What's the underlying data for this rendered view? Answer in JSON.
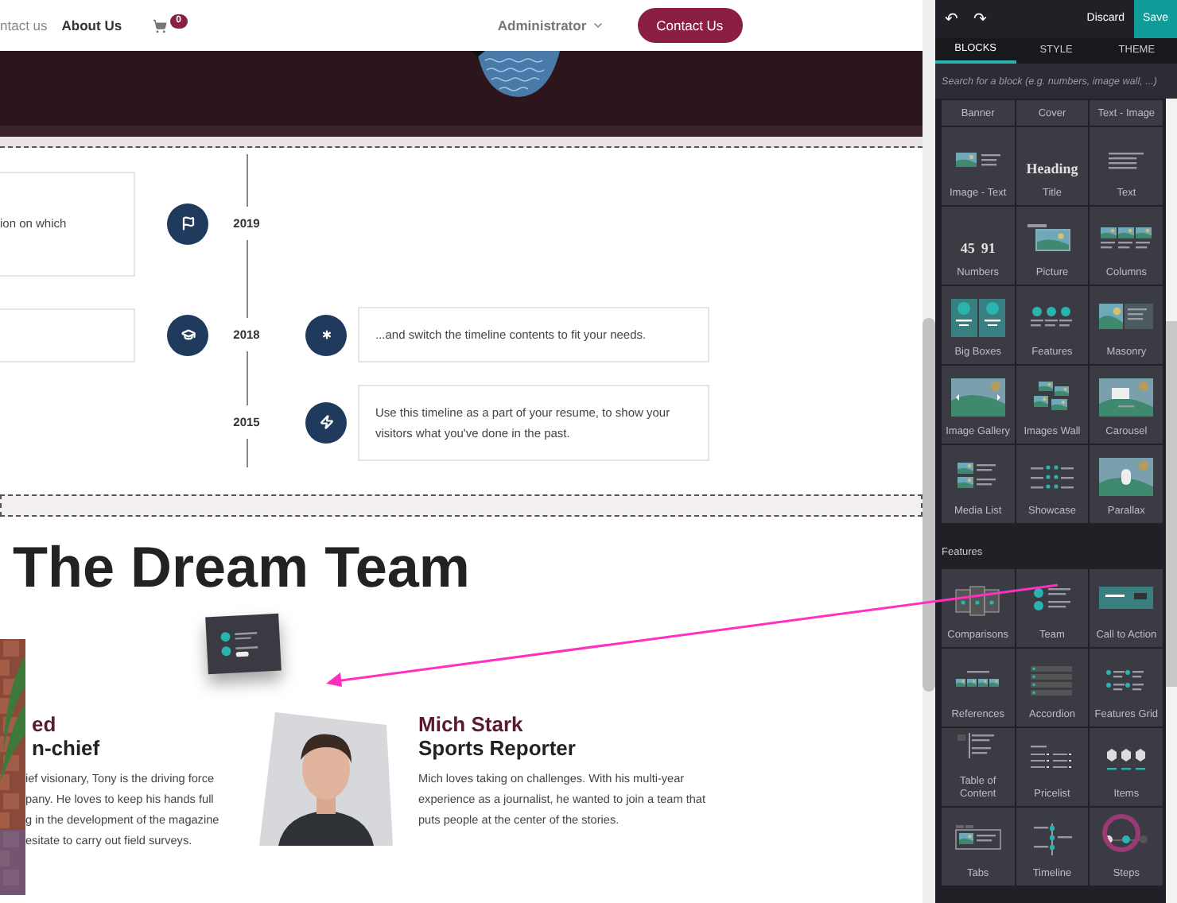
{
  "navbar": {
    "links": [
      {
        "label": "ntact us",
        "selected": false
      },
      {
        "label": "About Us",
        "selected": true
      }
    ],
    "cart_count": "0",
    "user": "Administrator",
    "cta": "Contact Us"
  },
  "timeline": {
    "rows": [
      {
        "year": "2019",
        "left_card": true,
        "left_text": "ion on which",
        "right_card": false
      },
      {
        "year": "2018",
        "left_card": true,
        "right_card": true,
        "right_text": "...and switch the timeline contents to fit your needs."
      },
      {
        "year": "2015",
        "left_card": false,
        "right_card": true,
        "right_text": "Use this timeline as a part of your resume, to show your visitors what you've done in the past."
      }
    ]
  },
  "team": {
    "heading": "The Dream Team",
    "members": [
      {
        "name": "ed",
        "role": "n-chief",
        "bio_lines": [
          "ief visionary, Tony is the driving force",
          "pany. He loves to keep his hands full",
          "g in the development of the magazine",
          "esitate to carry out field surveys."
        ]
      },
      {
        "name": "Mich Stark",
        "role": "Sports Reporter",
        "bio": "Mich loves taking on challenges. With his multi-year experience as a journalist, he wanted to join a team that puts people at the center of the stories."
      }
    ]
  },
  "panel": {
    "undo": "↶",
    "redo": "↷",
    "discard": "Discard",
    "save": "Save",
    "tabs": [
      {
        "label": "BLOCKS",
        "selected": true
      },
      {
        "label": "STYLE",
        "selected": false
      },
      {
        "label": "THEME",
        "selected": false
      }
    ],
    "search": {
      "placeholder": "Search for a block (e.g. numbers, image wall, ...)"
    },
    "sections": [
      {
        "blocks": [
          {
            "label": "Banner"
          },
          {
            "label": "Cover"
          },
          {
            "label": "Text - Image"
          },
          {
            "label": "Image - Text",
            "kind": "image-text"
          },
          {
            "label": "Title",
            "kind": "heading",
            "previews": [
              "Heading"
            ]
          },
          {
            "label": "Text",
            "kind": "text"
          },
          {
            "label": "Numbers",
            "kind": "numbers",
            "previews": [
              "45",
              "91"
            ]
          },
          {
            "label": "Picture",
            "kind": "picture"
          },
          {
            "label": "Columns",
            "kind": "columns"
          },
          {
            "label": "Big Boxes",
            "kind": "big-boxes"
          },
          {
            "label": "Features",
            "kind": "features"
          },
          {
            "label": "Masonry",
            "kind": "masonry"
          },
          {
            "label": "Image Gallery",
            "kind": "gallery"
          },
          {
            "label": "Images Wall",
            "kind": "wall"
          },
          {
            "label": "Carousel",
            "kind": "carousel"
          },
          {
            "label": "Media List",
            "kind": "media-list"
          },
          {
            "label": "Showcase",
            "kind": "showcase"
          },
          {
            "label": "Parallax",
            "kind": "parallax"
          }
        ]
      },
      {
        "title": "Features",
        "blocks": [
          {
            "label": "Comparisons",
            "kind": "comparisons"
          },
          {
            "label": "Team",
            "kind": "team"
          },
          {
            "label": "Call to Action",
            "kind": "cta"
          },
          {
            "label": "References",
            "kind": "references"
          },
          {
            "label": "Accordion",
            "kind": "accordion"
          },
          {
            "label": "Features Grid",
            "kind": "features-grid"
          },
          {
            "label": "Table of Content",
            "kind": "toc"
          },
          {
            "label": "Pricelist",
            "kind": "pricelist"
          },
          {
            "label": "Items",
            "kind": "items"
          },
          {
            "label": "Tabs",
            "kind": "tabs"
          },
          {
            "label": "Timeline",
            "kind": "timeline"
          },
          {
            "label": "Steps",
            "kind": "steps"
          }
        ]
      }
    ]
  }
}
